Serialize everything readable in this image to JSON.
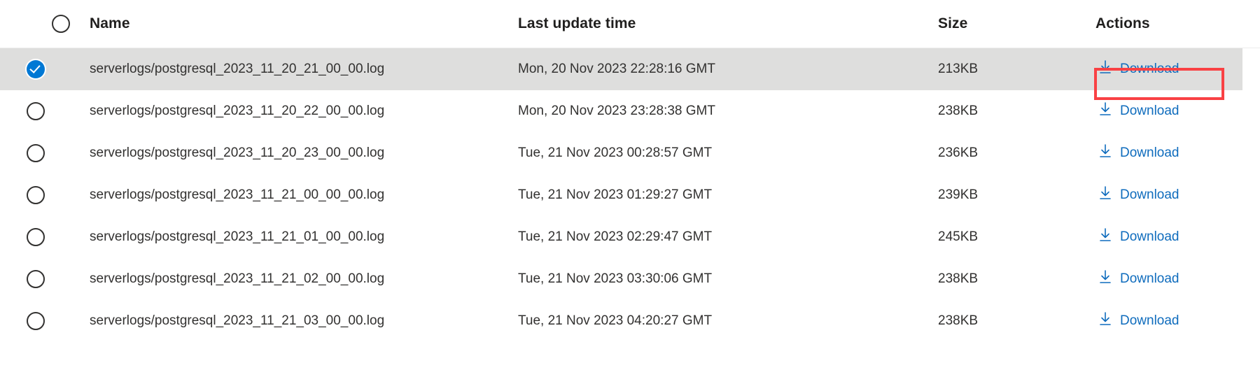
{
  "table": {
    "columns": {
      "select_all": "",
      "name": "Name",
      "last_update_time": "Last update time",
      "size": "Size",
      "actions": "Actions"
    },
    "action_label": "Download",
    "icons": {
      "download": "download-icon",
      "checkbox_checked": "checkbox-checked-icon",
      "checkbox_unchecked": "checkbox-unchecked-icon"
    },
    "rows": [
      {
        "name": "serverlogs/postgresql_2023_11_20_21_00_00.log",
        "last_update_time": "Mon, 20 Nov 2023 22:28:16 GMT",
        "size": "213KB",
        "action": "Download",
        "selected": true
      },
      {
        "name": "serverlogs/postgresql_2023_11_20_22_00_00.log",
        "last_update_time": "Mon, 20 Nov 2023 23:28:38 GMT",
        "size": "238KB",
        "action": "Download",
        "selected": false
      },
      {
        "name": "serverlogs/postgresql_2023_11_20_23_00_00.log",
        "last_update_time": "Tue, 21 Nov 2023 00:28:57 GMT",
        "size": "236KB",
        "action": "Download",
        "selected": false
      },
      {
        "name": "serverlogs/postgresql_2023_11_21_00_00_00.log",
        "last_update_time": "Tue, 21 Nov 2023 01:29:27 GMT",
        "size": "239KB",
        "action": "Download",
        "selected": false
      },
      {
        "name": "serverlogs/postgresql_2023_11_21_01_00_00.log",
        "last_update_time": "Tue, 21 Nov 2023 02:29:47 GMT",
        "size": "245KB",
        "action": "Download",
        "selected": false
      },
      {
        "name": "serverlogs/postgresql_2023_11_21_02_00_00.log",
        "last_update_time": "Tue, 21 Nov 2023 03:30:06 GMT",
        "size": "238KB",
        "action": "Download",
        "selected": false
      },
      {
        "name": "serverlogs/postgresql_2023_11_21_03_00_00.log",
        "last_update_time": "Tue, 21 Nov 2023 04:20:27 GMT",
        "size": "238KB",
        "action": "Download",
        "selected": false
      }
    ]
  },
  "annotation": {
    "target": "download-link-row-1",
    "color": "#f94144"
  },
  "colors": {
    "link": "#0f6cbd",
    "selected_row_bg": "#dededd",
    "text": "#323130",
    "header_text": "#201f1e",
    "checkbox_checked": "#0078d4",
    "divider": "#ededed",
    "annotation": "#f94144"
  }
}
